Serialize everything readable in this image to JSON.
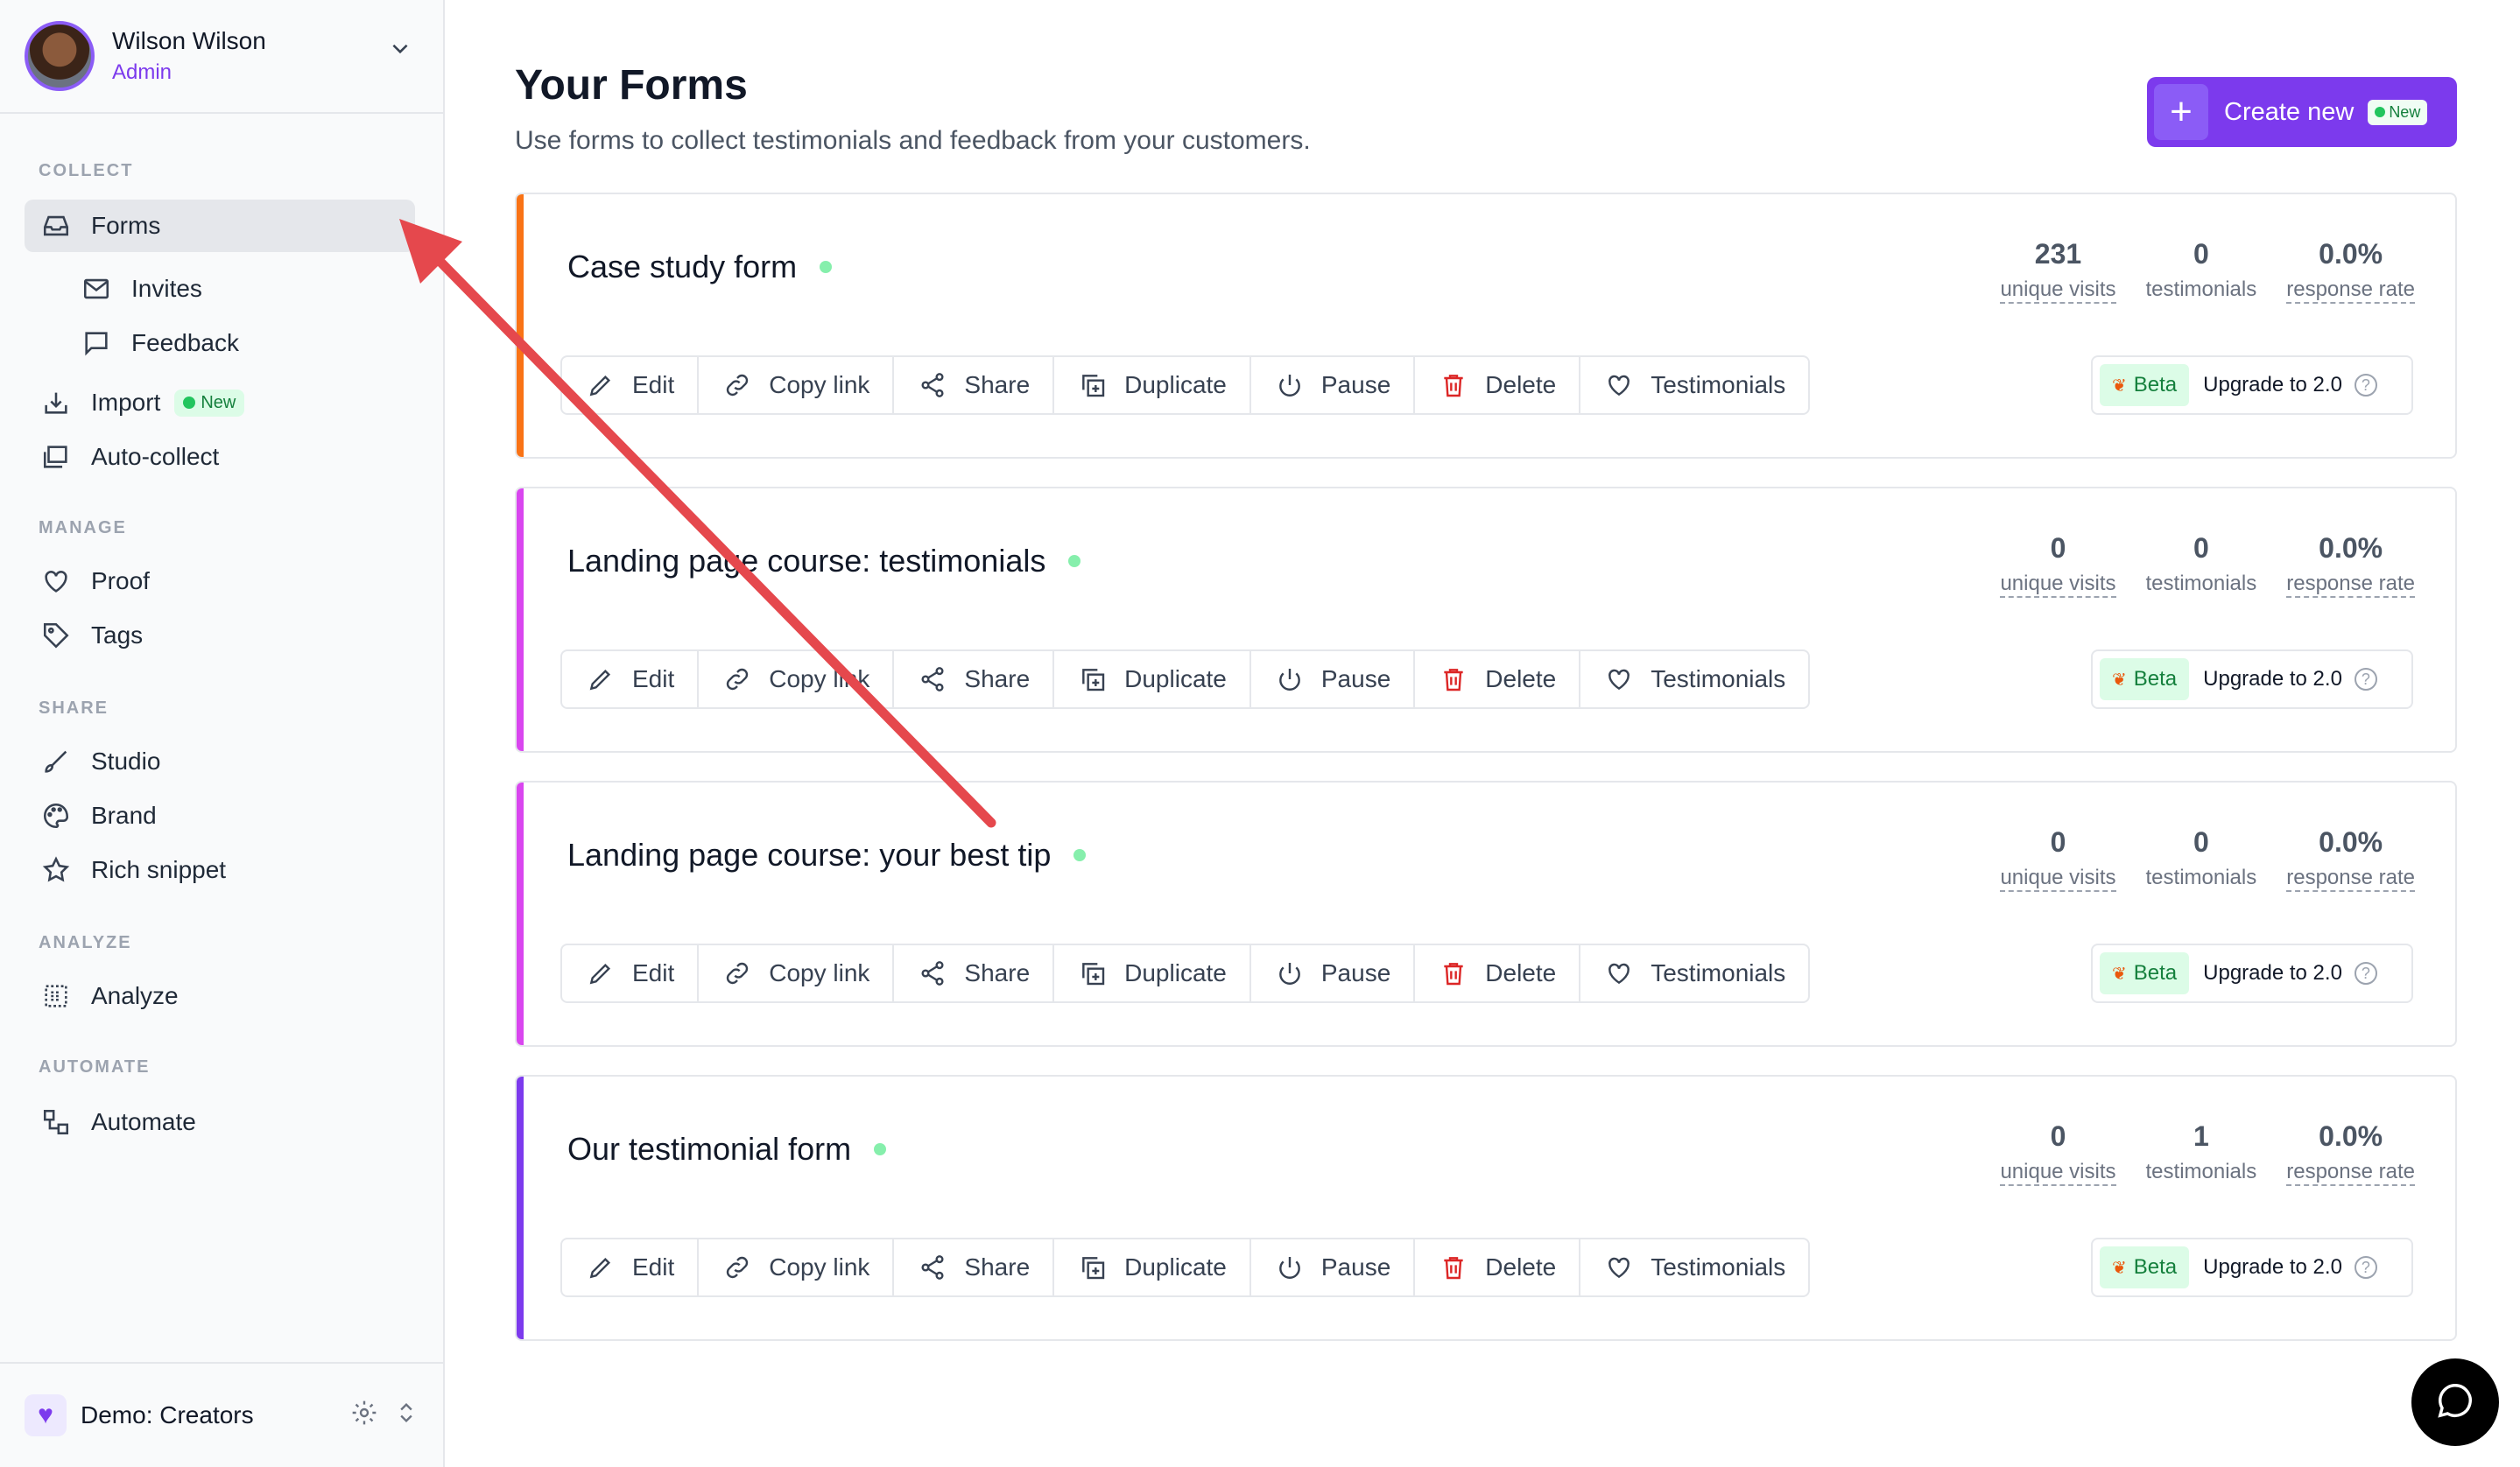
{
  "user": {
    "name": "Wilson Wilson",
    "role": "Admin"
  },
  "sidebar": {
    "sections": {
      "collect": "COLLECT",
      "manage": "MANAGE",
      "share": "SHARE",
      "analyze": "ANALYZE",
      "automate": "AUTOMATE"
    },
    "items": {
      "forms": "Forms",
      "invites": "Invites",
      "feedback": "Feedback",
      "import": "Import",
      "import_badge": "New",
      "auto_collect": "Auto-collect",
      "proof": "Proof",
      "tags": "Tags",
      "studio": "Studio",
      "brand": "Brand",
      "rich_snippet": "Rich snippet",
      "analyze": "Analyze",
      "automate": "Automate"
    },
    "workspace": "Demo: Creators"
  },
  "main": {
    "title": "Your Forms",
    "subtitle": "Use forms to collect testimonials and feedback from your customers.",
    "create_button": {
      "label": "Create new",
      "badge": "New"
    }
  },
  "action_labels": {
    "edit": "Edit",
    "copy_link": "Copy link",
    "share": "Share",
    "duplicate": "Duplicate",
    "pause": "Pause",
    "delete": "Delete",
    "testimonials": "Testimonials"
  },
  "stat_labels": {
    "visits": "unique visits",
    "testimonials": "testimonials",
    "rate": "response rate"
  },
  "beta": {
    "tag": "Beta",
    "upgrade": "Upgrade to 2.0",
    "help": "?"
  },
  "forms": [
    {
      "title": "Case study form",
      "accent": "#f97316",
      "visits": "231",
      "testimonials": "0",
      "rate": "0.0%"
    },
    {
      "title": "Landing page course: testimonials",
      "accent": "#d946ef",
      "visits": "0",
      "testimonials": "0",
      "rate": "0.0%"
    },
    {
      "title": "Landing page course: your best tip",
      "accent": "#d946ef",
      "visits": "0",
      "testimonials": "0",
      "rate": "0.0%"
    },
    {
      "title": "Our testimonial form",
      "accent": "#7c3aed",
      "visits": "0",
      "testimonials": "1",
      "rate": "0.0%"
    }
  ],
  "colors": {
    "brand": "#7c3aed",
    "arrow": "#e5484d",
    "live": "#86efac"
  }
}
